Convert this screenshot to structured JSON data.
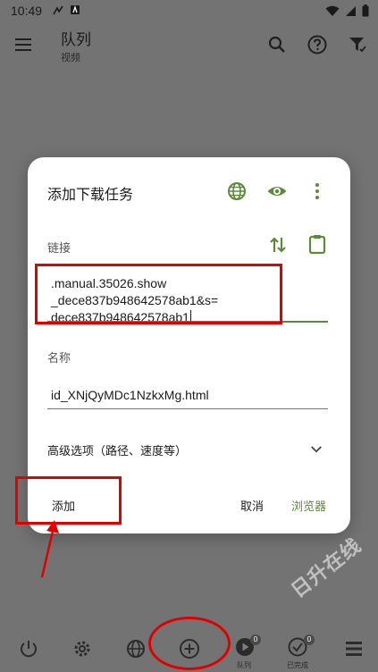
{
  "status_bar": {
    "time": "10:49"
  },
  "app_bar": {
    "title": "队列",
    "subtitle": "视频"
  },
  "dialog": {
    "title": "添加下载任务",
    "link_label": "链接",
    "url_lines": [
      ".manual.35026.show",
      "_dece837b948642578ab1&s=",
      "dece837b948642578ab1"
    ],
    "name_label": "名称",
    "name_value": "id_XNjQyMDc1NzkxMg.html",
    "advanced_label": "高级选项（路径、速度等）",
    "add_button": "添加",
    "cancel_button": "取消",
    "browser_button": "浏览器"
  },
  "bottom_nav": {
    "queue_label": "队列",
    "queue_badge": "0",
    "completed_label": "已完成",
    "completed_badge": "0"
  },
  "watermark": "日升在线",
  "colors": {
    "accent": "#5d8a3a",
    "dim_background": "#737373",
    "annotation_red": "#e00000"
  }
}
